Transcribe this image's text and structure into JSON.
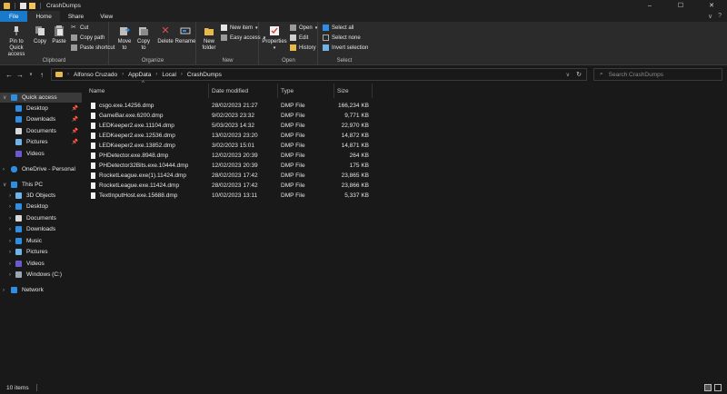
{
  "window": {
    "title": "CrashDumps",
    "controls": {
      "minimize": "–",
      "maximize": "☐",
      "close": "✕"
    }
  },
  "tabs": [
    {
      "label": "File"
    },
    {
      "label": "Home"
    },
    {
      "label": "Share"
    },
    {
      "label": "View"
    }
  ],
  "tabs_right": {
    "expand": "∨",
    "help": "?"
  },
  "ribbon": {
    "clipboard": {
      "label": "Clipboard",
      "pin_label": "Pin to Quick access",
      "copy_label": "Copy",
      "paste_label": "Paste",
      "cut_label": "Cut",
      "copy_path_label": "Copy path",
      "paste_shortcut_label": "Paste shortcut"
    },
    "organize": {
      "label": "Organize",
      "move_to_label": "Move to",
      "copy_to_label": "Copy to",
      "delete_label": "Delete",
      "rename_label": "Rename"
    },
    "new": {
      "label": "New",
      "new_folder_label": "New folder",
      "new_item_label": "New item",
      "easy_access_label": "Easy access"
    },
    "open": {
      "label": "Open",
      "properties_label": "Properties",
      "open_label": "Open",
      "edit_label": "Edit",
      "history_label": "History"
    },
    "select": {
      "label": "Select",
      "select_all_label": "Select all",
      "select_none_label": "Select none",
      "invert_selection_label": "Invert selection"
    }
  },
  "addressbar": {
    "back": "←",
    "forward": "→",
    "recent": "∨",
    "up": "↑",
    "crumbs": [
      "Alfonso Cruzado",
      "AppData",
      "Local",
      "CrashDumps"
    ],
    "crumb_separator": "›",
    "dropdown": "∨",
    "refresh": "↻"
  },
  "search": {
    "placeholder": "Search CrashDumps",
    "icon": "⌕"
  },
  "sidebar": {
    "items": [
      {
        "label": "Quick access",
        "icon": "star-icon",
        "color": "#2f8de4"
      },
      {
        "label": "Desktop",
        "icon": "desktop-icon",
        "color": "#2f8de4",
        "pinned": true
      },
      {
        "label": "Downloads",
        "icon": "downloads-icon",
        "color": "#2f8de4",
        "pinned": true
      },
      {
        "label": "Documents",
        "icon": "documents-icon",
        "color": "#d9d9d9",
        "pinned": true
      },
      {
        "label": "Pictures",
        "icon": "pictures-icon",
        "color": "#6fb3e8",
        "pinned": true
      },
      {
        "label": "Videos",
        "icon": "videos-icon",
        "color": "#6a5acd"
      },
      {
        "label": "OneDrive - Personal",
        "icon": "onedrive-icon",
        "color": "#2f8de4"
      },
      {
        "label": "This PC",
        "icon": "this-pc-icon",
        "color": "#2f8de4"
      },
      {
        "label": "3D Objects",
        "icon": "3d-objects-icon",
        "color": "#6fb3e8"
      },
      {
        "label": "Desktop",
        "icon": "desktop-icon",
        "color": "#2f8de4"
      },
      {
        "label": "Documents",
        "icon": "documents-icon",
        "color": "#d9d9d9"
      },
      {
        "label": "Downloads",
        "icon": "downloads-icon",
        "color": "#2f8de4"
      },
      {
        "label": "Music",
        "icon": "music-icon",
        "color": "#2f8de4"
      },
      {
        "label": "Pictures",
        "icon": "pictures-icon",
        "color": "#6fb3e8"
      },
      {
        "label": "Videos",
        "icon": "videos-icon",
        "color": "#6a5acd"
      },
      {
        "label": "Windows (C:)",
        "icon": "drive-icon",
        "color": "#9aa7b3"
      },
      {
        "label": "Network",
        "icon": "network-icon",
        "color": "#2f8de4"
      }
    ],
    "pin_glyph": "📌",
    "expander_glyph": "›"
  },
  "columns": {
    "name": "Name",
    "date": "Date modified",
    "type": "Type",
    "size": "Size",
    "sort_glyph": "^"
  },
  "files": [
    {
      "name": "csgo.exe.14256.dmp",
      "date": "28/02/2023 21:27",
      "type": "DMP File",
      "size": "166,234 KB"
    },
    {
      "name": "GameBar.exe.6200.dmp",
      "date": "9/02/2023 23:32",
      "type": "DMP File",
      "size": "9,771 KB"
    },
    {
      "name": "LEDKeeper2.exe.11104.dmp",
      "date": "5/03/2023 14:32",
      "type": "DMP File",
      "size": "22,970 KB"
    },
    {
      "name": "LEDKeeper2.exe.12536.dmp",
      "date": "13/02/2023 23:20",
      "type": "DMP File",
      "size": "14,872 KB"
    },
    {
      "name": "LEDKeeper2.exe.13852.dmp",
      "date": "3/02/2023 15:01",
      "type": "DMP File",
      "size": "14,871 KB"
    },
    {
      "name": "PHDetector.exe.8948.dmp",
      "date": "12/02/2023 20:39",
      "type": "DMP File",
      "size": "264 KB"
    },
    {
      "name": "PHDetector32Bits.exe.10444.dmp",
      "date": "12/02/2023 20:39",
      "type": "DMP File",
      "size": "175 KB"
    },
    {
      "name": "RocketLeague.exe(1).11424.dmp",
      "date": "28/02/2023 17:42",
      "type": "DMP File",
      "size": "23,865 KB"
    },
    {
      "name": "RocketLeague.exe.11424.dmp",
      "date": "28/02/2023 17:42",
      "type": "DMP File",
      "size": "23,866 KB"
    },
    {
      "name": "TextInputHost.exe.15688.dmp",
      "date": "10/02/2023 13:11",
      "type": "DMP File",
      "size": "5,337 KB"
    }
  ],
  "status": {
    "item_count": "10 items"
  }
}
